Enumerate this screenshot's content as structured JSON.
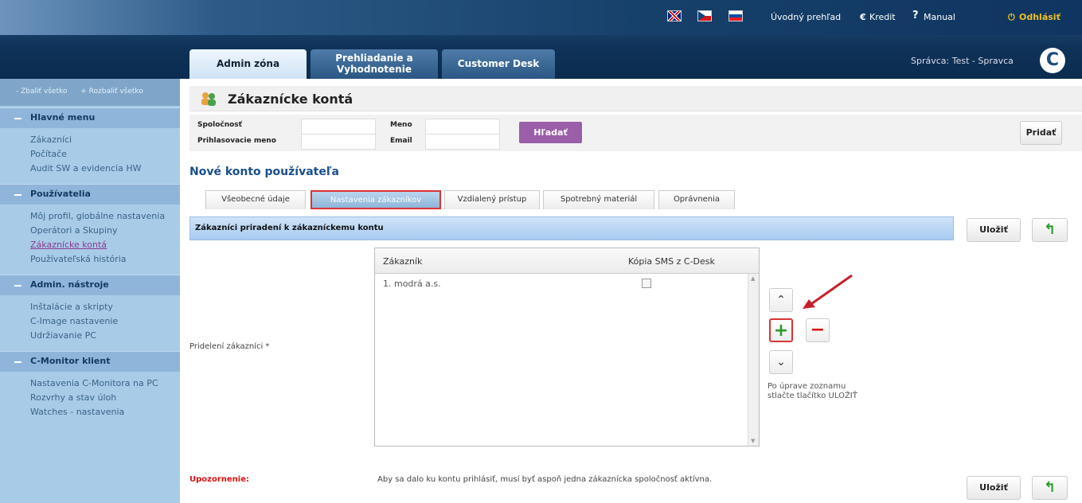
{
  "topbar": {
    "nav_overview": "Úvodný prehľad",
    "nav_credit": "Kredit",
    "nav_manual": "Manual",
    "nav_logout": "Odhlásiť",
    "admin_user": "Správca: Test - Spravca",
    "logo_letter": "C"
  },
  "main_tabs": [
    {
      "label": "Admin zóna"
    },
    {
      "label": "Prehliadanie a Vyhodnotenie"
    },
    {
      "label": "Customer Desk"
    }
  ],
  "sidebar": {
    "collapse_all": "Zbaliť všetko",
    "expand_all": "Rozbaliť všetko",
    "groups": [
      {
        "title": "Hlavné menu",
        "items": [
          "Zákazníci",
          "Počítače",
          "Audit SW a evidencia HW"
        ]
      },
      {
        "title": "Používatelia",
        "items": [
          "Môj profil, globálne nastavenia",
          "Operátori a Skupiny",
          "Zákaznícke kontá",
          "Používateľská história"
        ]
      },
      {
        "title": "Admin. nástroje",
        "items": [
          "Inštalácie a skripty",
          "C-Image nastavenie",
          "Udržiavanie PC"
        ]
      },
      {
        "title": "C-Monitor klient",
        "items": [
          "Nastavenia C-Monitora na PC",
          "Rozvrhy a stav úloh",
          "Watches - nastavenia"
        ]
      }
    ]
  },
  "page": {
    "title": "Zákaznícke kontá",
    "section_title": "Nové konto používateľa"
  },
  "filter": {
    "company_label": "Spoločnosť",
    "login_label": "Prihlasovacie meno",
    "name_label": "Meno",
    "email_label": "Email",
    "company_value": "",
    "login_value": "",
    "name_value": "",
    "email_value": "",
    "search_button": "Hľadať",
    "add_button": "Pridať"
  },
  "subtabs": [
    "Všeobecné údaje",
    "Nastavenia zákazníkov",
    "Vzdialený prístup",
    "Spotrebný materiál",
    "Oprávnenia"
  ],
  "panel": {
    "bar_title": "Zákazníci priradení k zákazníckemu kontu",
    "save_button": "Uložiť",
    "field_label": "Pridelení zákazníci *",
    "grid_headers": {
      "customer": "Zákazník",
      "sms_copy": "Kópia SMS z C-Desk"
    },
    "rows": [
      {
        "customer": "1. modrá a.s.",
        "sms_copy": false
      }
    ],
    "hint": "Po úprave zoznamu stlačte tlačítko ULOŽIŤ",
    "warning_label": "Upozornenie:",
    "warning_text": "Aby sa dalo ku kontu prihlásiť, musí byť aspoň jedna zákaznícka spoločnosť aktívna."
  },
  "colors": {
    "accent_purple": "#9a5fa8",
    "highlight_red": "#d33",
    "brand_blue": "#1a4f8a"
  }
}
